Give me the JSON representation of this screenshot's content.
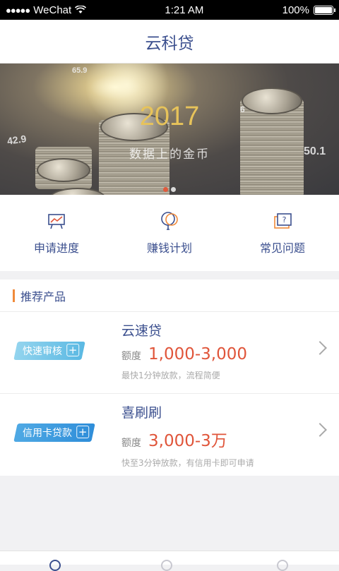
{
  "status_bar": {
    "carrier": "WeChat",
    "time": "1:21 AM",
    "battery": "100%"
  },
  "nav": {
    "title": "云科贷"
  },
  "banner": {
    "year": "2017",
    "subtitle": "数据上的金币",
    "overlay_numbers": [
      "65.9",
      "42.9",
      "50.1",
      "6"
    ],
    "active_page": 1,
    "page_count": 2
  },
  "quick_actions": [
    {
      "label": "申请进度",
      "icon": "chart-board-icon"
    },
    {
      "label": "赚钱计划",
      "icon": "balloon-icon"
    },
    {
      "label": "常见问题",
      "icon": "question-icon"
    }
  ],
  "recommend": {
    "title": "推荐产品",
    "products": [
      {
        "tag": "快速审核",
        "name": "云速贷",
        "quota_label": "额度",
        "quota": "1,000-3,000",
        "desc": "最快1分钟放款，流程简便"
      },
      {
        "tag": "信用卡贷款",
        "name": "喜刷刷",
        "quota_label": "额度",
        "quota": "3,000-3万",
        "desc": "快至3分钟放款，有信用卡即可申请"
      }
    ]
  },
  "colors": {
    "accent": "#3b4f8e",
    "price": "#e0553a",
    "section_bar": "#f08a3a"
  }
}
